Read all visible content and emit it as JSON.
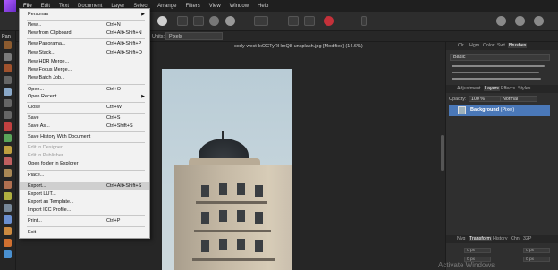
{
  "menubar": {
    "items": [
      "File",
      "Edit",
      "Text",
      "Document",
      "Layer",
      "Select",
      "Arrange",
      "Filters",
      "View",
      "Window",
      "Help"
    ]
  },
  "context_bar": {
    "units_label": "Units:",
    "units_value": "Pixels"
  },
  "tools": {
    "pan_label": "Pan"
  },
  "document": {
    "tab_title": "cody-west-IxOCTyRHmQ8-unsplash.jpg [Modified] (14.6%)"
  },
  "file_menu": {
    "items": [
      {
        "label": "Personas",
        "shortcut": "",
        "submenu": true,
        "disabled": false
      },
      {
        "label": "New...",
        "shortcut": "Ctrl+N",
        "disabled": false
      },
      {
        "label": "New from Clipboard",
        "shortcut": "Ctrl+Alt+Shift+N",
        "disabled": false
      },
      {
        "label": "New Panorama...",
        "shortcut": "Ctrl+Alt+Shift+P",
        "disabled": false
      },
      {
        "label": "New Stack...",
        "shortcut": "Ctrl+Alt+Shift+O",
        "disabled": false
      },
      {
        "label": "New HDR Merge...",
        "shortcut": "",
        "disabled": false
      },
      {
        "label": "New Focus Merge...",
        "shortcut": "",
        "disabled": false
      },
      {
        "label": "New Batch Job...",
        "shortcut": "",
        "disabled": false
      },
      {
        "label": "Open...",
        "shortcut": "Ctrl+O",
        "disabled": false
      },
      {
        "label": "Open Recent",
        "shortcut": "",
        "submenu": true,
        "disabled": false
      },
      {
        "label": "Close",
        "shortcut": "Ctrl+W",
        "disabled": false
      },
      {
        "label": "Save",
        "shortcut": "Ctrl+S",
        "disabled": false
      },
      {
        "label": "Save As...",
        "shortcut": "Ctrl+Shift+S",
        "disabled": false
      },
      {
        "label": "Save History With Document",
        "shortcut": "",
        "disabled": false
      },
      {
        "label": "Edit in Designer...",
        "shortcut": "",
        "disabled": true
      },
      {
        "label": "Edit in Publisher...",
        "shortcut": "",
        "disabled": true
      },
      {
        "label": "Open folder in Explorer",
        "shortcut": "",
        "disabled": false
      },
      {
        "label": "Place...",
        "shortcut": "",
        "disabled": false
      },
      {
        "label": "Export...",
        "shortcut": "Ctrl+Alt+Shift+S",
        "disabled": false,
        "highlighted": true
      },
      {
        "label": "Export LUT...",
        "shortcut": "",
        "disabled": false
      },
      {
        "label": "Export as Template...",
        "shortcut": "",
        "disabled": false
      },
      {
        "label": "Import ICC Profile...",
        "shortcut": "",
        "disabled": false
      },
      {
        "label": "Print...",
        "shortcut": "Ctrl+P",
        "disabled": false
      },
      {
        "label": "Exit",
        "shortcut": "",
        "disabled": false
      }
    ]
  },
  "right_panel": {
    "top_tabs": [
      "Clr",
      "Hgm",
      "Color",
      "Swt",
      "Brushes"
    ],
    "brush_category": "Basic",
    "mid_tabs": [
      "Adjustment",
      "Layers",
      "Effects",
      "Styles"
    ],
    "opacity_label": "Opacity:",
    "opacity_value": "100 %",
    "blend_mode": "Normal",
    "layer": {
      "name": "Background",
      "type": "(Pixel)"
    },
    "bottom_tabs": [
      "Nvg",
      "Transform",
      "History",
      "Chn",
      "32P"
    ],
    "transform_values": [
      "0 px",
      "0 px",
      "0 px",
      "0 px"
    ]
  },
  "watermark": "Activate Windows",
  "colors": {
    "accent": "#4a78b8",
    "menu_bg": "#f2f2f2",
    "app_bg": "#2b2b2b"
  }
}
